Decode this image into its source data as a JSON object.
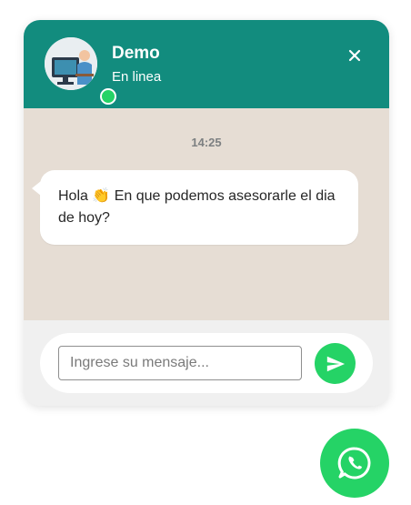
{
  "header": {
    "name": "Demo",
    "status": "En linea",
    "background_color": "#128c7e"
  },
  "conversation": {
    "timestamp": "14:25",
    "messages": [
      {
        "from": "agent",
        "text": "Hola 👏 En que podemos asesorarle el dia de hoy?"
      }
    ],
    "background_color": "#e6ddd4"
  },
  "composer": {
    "placeholder": "Ingrese su mensaje...",
    "value": "",
    "send_icon": "send-icon",
    "accent_color": "#25d366"
  },
  "launcher": {
    "icon": "whatsapp-icon",
    "color": "#25d366"
  }
}
